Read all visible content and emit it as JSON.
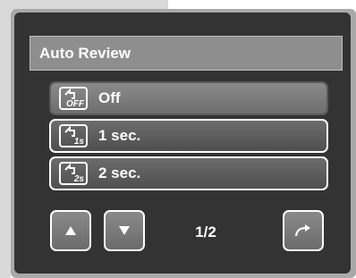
{
  "screen": {
    "title": "Auto Review",
    "menu_items": [
      {
        "label": "Off",
        "icon_sub": "OFF",
        "icon": "review-off-icon",
        "selected": true
      },
      {
        "label": "1 sec.",
        "icon_sub": "1s",
        "icon": "review-1s-icon",
        "selected": false
      },
      {
        "label": "2 sec.",
        "icon_sub": "2s",
        "icon": "review-2s-icon",
        "selected": false
      }
    ],
    "page_indicator": "1/2",
    "buttons": {
      "up": "up-arrow-icon",
      "down": "down-arrow-icon",
      "return": "return-arrow-icon"
    }
  },
  "colors": {
    "background": "#333333",
    "title_bar": "#8e8e8e",
    "text": "#ffffff"
  }
}
